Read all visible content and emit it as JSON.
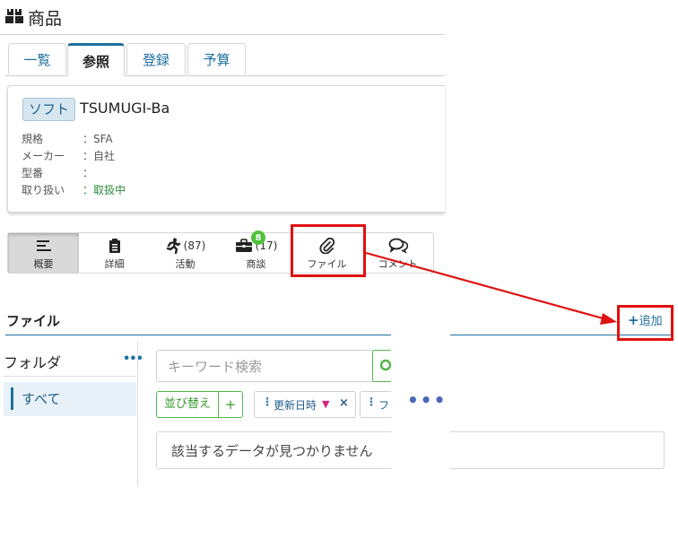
{
  "header": {
    "title": "商品",
    "icon": "boxes-icon"
  },
  "tabs": [
    {
      "label": "一覧"
    },
    {
      "label": "参照",
      "active": true
    },
    {
      "label": "登録"
    },
    {
      "label": "予算"
    }
  ],
  "product": {
    "badge": "ソフト",
    "name": "TSUMUGI-Ba",
    "props": [
      {
        "key": "規格",
        "value": "：SFA"
      },
      {
        "key": "メーカー",
        "value": "：自社"
      },
      {
        "key": "型番",
        "value": "："
      },
      {
        "key": "取り扱い",
        "value": "：取扱中"
      }
    ]
  },
  "subtabs": [
    {
      "label": "概要",
      "icon": "list-icon",
      "count": "",
      "active": true
    },
    {
      "label": "詳細",
      "icon": "clipboard-icon",
      "count": ""
    },
    {
      "label": "活動",
      "icon": "running-icon",
      "count": "(87)"
    },
    {
      "label": "商談",
      "icon": "briefcase-icon",
      "count": "(17)",
      "badge": "8"
    },
    {
      "label": "ファイル",
      "icon": "paperclip-icon",
      "count": ""
    },
    {
      "label": "コメント",
      "icon": "comments-icon",
      "count": ""
    }
  ],
  "files": {
    "title": "ファイル",
    "add_label": "追加",
    "folder_label": "フォルダ",
    "folder_all": "すべて",
    "search_placeholder": "キーワード検索",
    "sort_label": "並び替え",
    "sort_plus": "+",
    "sort_chip": "更新日時",
    "chip2_label": "フ",
    "empty_text": "該当するデータが見つかりません"
  },
  "colors": {
    "accent": "#1f6f9f",
    "green": "#52b548",
    "annotation": "#e01010",
    "badge_green": "#4fc23a"
  }
}
